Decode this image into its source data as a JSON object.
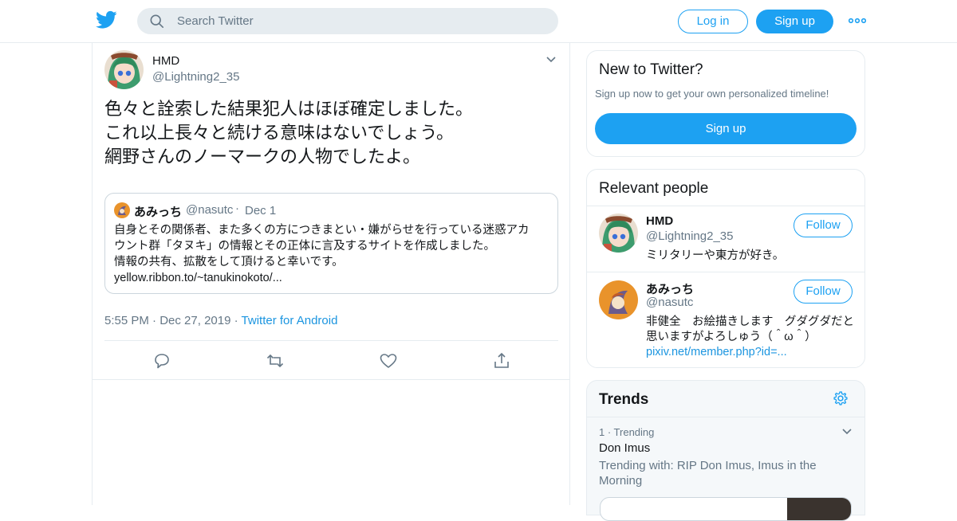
{
  "header": {
    "search_placeholder": "Search Twitter",
    "login_label": "Log in",
    "signup_label": "Sign up"
  },
  "tweet": {
    "author_name": "HMD",
    "author_handle": "@Lightning2_35",
    "text_lines": [
      "色々と詮索した結果犯人はほぼ確定しました。",
      "これ以上長々と続ける意味はないでしょう。",
      "網野さんのノーマークの人物でしたよ。"
    ],
    "quote": {
      "name": "あみっち",
      "handle": "@nasutc",
      "dot": "·",
      "date": "Dec 1",
      "text_lines": [
        "自身とその関係者、また多くの方につきまとい・嫌がらせを行っている迷惑アカ",
        "ウント群「タヌキ」の情報とその正体に言及するサイトを作成しました。",
        "情報の共有、拡散をして頂けると幸いです。",
        "yellow.ribbon.to/~tanukinokoto/..."
      ]
    },
    "time": "5:55 PM",
    "date": "Dec 27, 2019",
    "source": "Twitter for Android"
  },
  "sidebar": {
    "new": {
      "title": "New to Twitter?",
      "subtitle": "Sign up now to get your own personalized timeline!",
      "button": "Sign up"
    },
    "people": {
      "title": "Relevant people",
      "follow_label": "Follow",
      "items": [
        {
          "name": "HMD",
          "handle": "@Lightning2_35",
          "bio": "ミリタリーや東方が好き。",
          "link": ""
        },
        {
          "name": "あみっち",
          "handle": "@nasutc",
          "bio": "非健全　お絵描きします　グダグダだと思いますがよろしゅう（＾ω＾）",
          "link": "pixiv.net/member.php?id=..."
        }
      ]
    },
    "trends": {
      "title": "Trends",
      "items": [
        {
          "rank": "1 · Trending",
          "name": "Don Imus",
          "with": "Trending with: RIP Don Imus, Imus in the Morning"
        }
      ]
    }
  },
  "colors": {
    "accent": "#1da1f2",
    "link": "#1b95e0",
    "muted": "#657786",
    "border": "#e6ecf0"
  }
}
